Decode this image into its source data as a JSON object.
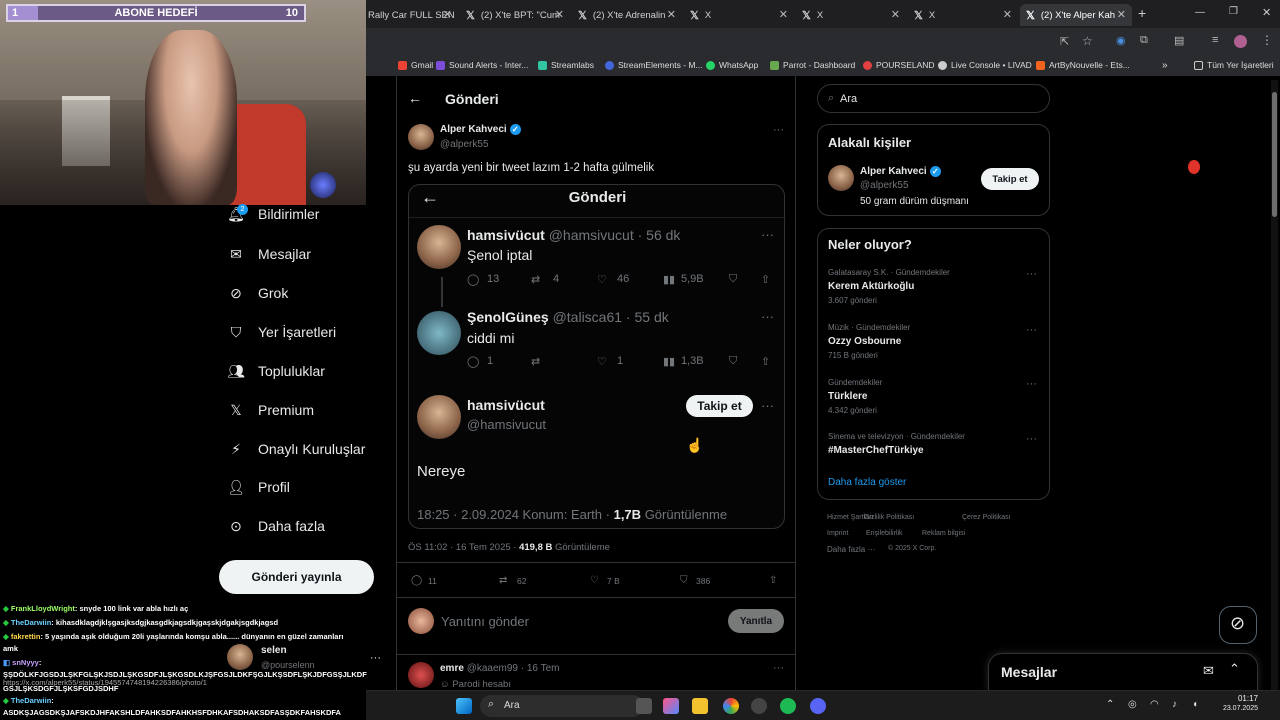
{
  "colors": {
    "accent": "#1d9bf0",
    "bg": "#000000",
    "border": "#2f3336",
    "muted": "#71767b"
  },
  "stream_goal": {
    "left": "1",
    "title": "ABONE HEDEFİ",
    "right": "10",
    "progress": 0.1
  },
  "browser": {
    "tabs": [
      {
        "label": "Rally Car FULL SEN"
      },
      {
        "label": "(2) X'te BPT: \"Cum"
      },
      {
        "label": "(2) X'te Adrenalin"
      },
      {
        "label": "X"
      },
      {
        "label": "X"
      },
      {
        "label": "X"
      },
      {
        "label": "(2) X'te Alper Kah"
      }
    ],
    "new_tab": "+",
    "bookmarks": [
      "Gmail",
      "Sound Alerts - Inter...",
      "Streamlabs",
      "StreamElements - M...",
      "WhatsApp",
      "Parrot - Dashboard",
      "POURSELAND",
      "Live Console • LIVAD",
      "ArtByNouvelle - Ets..."
    ],
    "bookmarks_more": "»",
    "all_bookmarks": "Tüm Yer İşaretleri"
  },
  "nav": {
    "items": [
      "Bildirimler",
      "Mesajlar",
      "Grok",
      "Yer İşaretleri",
      "Topluluklar",
      "Premium",
      "Onaylı Kuruluşlar",
      "Profil",
      "Daha fazla"
    ],
    "post_button": "Gönderi yayınla",
    "notif_badge": "2"
  },
  "chat": [
    {
      "user": "FrankLloydWright",
      "text": ": snyde 100 link var abla hızlı aç"
    },
    {
      "user": "TheDarwiin",
      "text": ": kihasdklagdjklşgasjksdgjkasgdkjagsdkjgaşskjdgakjsgdkjagsd"
    },
    {
      "user": "fakrettin",
      "text": ": 5 yaşında aşık olduğum 20li yaşlarında komşu abla...... dünyanın en güzel zamanları"
    },
    {
      "user": "",
      "text": "amk"
    },
    {
      "user": "snNyyy",
      "text": ":"
    },
    {
      "user": "",
      "text": "ŞŞDÖLKFJGSDJLŞKFGLŞKJSDJLŞKGSDFJLŞKGSDLKJŞFGSJLDKFŞGJLKŞSDFLŞKJDFGSŞJLKDF"
    },
    {
      "user": "",
      "text": "GSJLŞKSDGFJLŞKSFGDJSDHF"
    },
    {
      "user": "TheDarwiin",
      "text": ":"
    },
    {
      "user": "",
      "text": "ASDKŞJAGSDKŞJAFSKDJHFAKSHLDFAHKSDFAHKHSFDHKAFSDHAKSDFASŞDKFAHSKDFA"
    }
  ],
  "account": {
    "name": "selen",
    "handle": "@pourselenn",
    "url": "https://x.com/alperk55/status/1945574748194226386/photo/1"
  },
  "main": {
    "header": "Gönderi",
    "author": {
      "name": "Alper Kahveci",
      "handle": "@alperk55"
    },
    "text": "şu ayarda yeni bir tweet lazım 1-2 hafta gülmelik",
    "embedded": {
      "header": "Gönderi",
      "t1": {
        "name": "hamsivücut",
        "handle": "@hamsivucut · 56 dk",
        "text": "Şenol iptal",
        "replies": "13",
        "rts": "4",
        "likes": "46",
        "views": "5,9B"
      },
      "t2": {
        "name": "ŞenolGüneş",
        "handle": "@talisca61 · 55 dk",
        "text": "ciddi mi",
        "replies": "1",
        "rts": "",
        "likes": "1",
        "views": "1,3B"
      },
      "t3": {
        "name": "hamsivücut",
        "handle": "@hamsivucut",
        "follow": "Takip et",
        "text": "Nereye",
        "meta_pre": "18:25 · 2.09.2024 Konum: Earth ·",
        "meta_views": "1,7B",
        "meta_post": "Görüntülenme"
      }
    },
    "timestamp": "ÖS 11:02 · 16 Tem 2025 ·",
    "views": "419,8 B",
    "views_label": "Görüntüleme",
    "stats": {
      "replies": "11",
      "rts": "62",
      "likes": "7 B",
      "bookmarks": "386"
    },
    "reply_placeholder": "Yanıtını gönder",
    "reply_button": "Yanıtla",
    "next": {
      "name": "emre",
      "handle": "@kaaem99 · 16 Tem",
      "tag": "Parodi hesabı"
    }
  },
  "right": {
    "search_placeholder": "Ara",
    "related_title": "Alakalı kişiler",
    "related": {
      "name": "Alper Kahveci",
      "handle": "@alperk55",
      "bio": "50 gram dürüm düşmanı",
      "follow": "Takip et"
    },
    "trends_title": "Neler oluyor?",
    "trends": [
      {
        "meta": "Galatasaray S.K. · Gündemdekiler",
        "name": "Kerem Aktürkoğlu",
        "count": "3.607 gönderi"
      },
      {
        "meta": "Müzik · Gündemdekiler",
        "name": "Ozzy Osbourne",
        "count": "715 B gönderi"
      },
      {
        "meta": "Gündemdekiler",
        "name": "Türklere",
        "count": "4.342 gönderi"
      },
      {
        "meta": "Sinema ve televizyon · Gündemdekiler",
        "name": "#MasterChefTürkiye",
        "count": ""
      }
    ],
    "show_more": "Daha fazla göster",
    "footer": [
      "Hizmet Şartları",
      "Gizlilik Politikası",
      "Çerez Politikası",
      "Imprint",
      "Erişilebilirlik",
      "Reklam bilgisi",
      "Daha fazla ···",
      "© 2025 X Corp."
    ],
    "messages": "Mesajlar"
  },
  "taskbar": {
    "search": "Ara",
    "time": "01:17",
    "date": "23.07.2025"
  }
}
